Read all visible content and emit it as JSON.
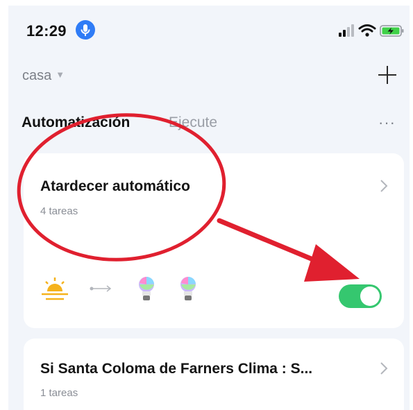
{
  "status_bar": {
    "time": "12:29",
    "mic_icon": "microphone-icon",
    "signal_icon": "cellular-signal-icon",
    "wifi_icon": "wifi-icon",
    "battery_icon": "battery-charging-icon"
  },
  "header": {
    "home_name": "casa",
    "home_caret_icon": "caret-down-icon",
    "add_icon": "plus-icon"
  },
  "tabs": {
    "items": [
      {
        "label": "Automatización",
        "active": true
      },
      {
        "label": "Ejecute",
        "active": false
      }
    ],
    "more_label": "···"
  },
  "automations": [
    {
      "title": "Atardecer automático",
      "subtitle": "4 tareas",
      "enabled": true,
      "condition_icon": "sunset-icon",
      "action_icons": [
        "arrow-right-icon",
        "light-bulb-icon",
        "light-bulb-icon"
      ]
    },
    {
      "title": "Si Santa Coloma de Farners Clima : S...",
      "subtitle": "1 tareas"
    }
  ],
  "colors": {
    "screen_background": "#f2f5fa",
    "card_background": "#ffffff",
    "toggle_on": "#35c76f",
    "annotation_red": "#e0202f",
    "mic_blue": "#2f7cf6",
    "battery_green": "#3fd148"
  }
}
